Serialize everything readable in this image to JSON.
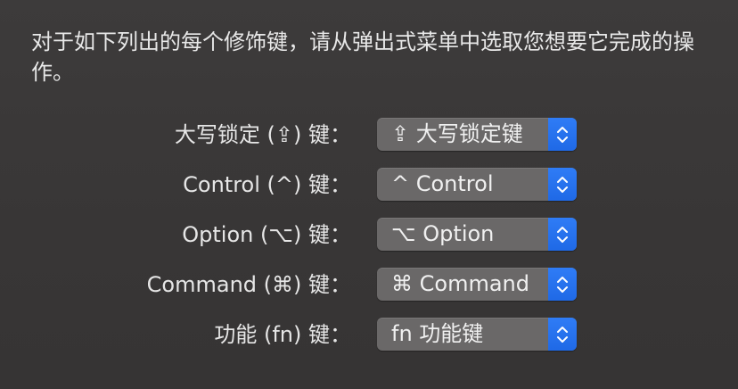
{
  "intro_text": "对于如下列出的每个修饰键，请从弹出式菜单中选取您想要它完成的操作。",
  "accent_color": "#2a74f0",
  "rows": [
    {
      "label": "大写锁定 (⇪) 键：",
      "value": "⇪ 大写锁定键"
    },
    {
      "label": "Control (^) 键：",
      "value": "^ Control"
    },
    {
      "label": "Option (⌥) 键：",
      "value": "⌥ Option"
    },
    {
      "label": "Command (⌘) 键：",
      "value": "⌘ Command"
    },
    {
      "label": "功能 (fn) 键：",
      "value": "fn 功能键"
    }
  ],
  "stepper_icon": "up-down-chevrons-icon"
}
